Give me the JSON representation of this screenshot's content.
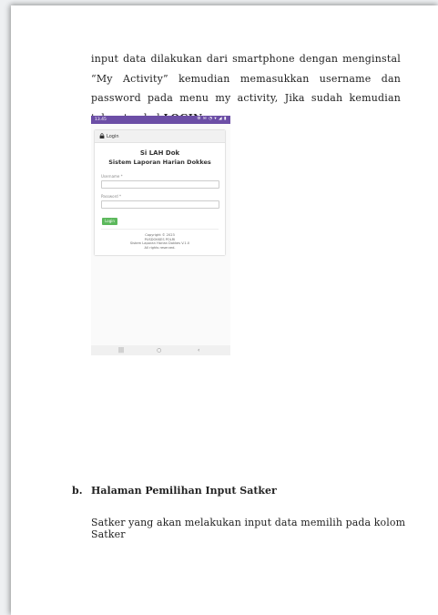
{
  "paragraph1": {
    "text": "input data dilakukan dari smartphone dengan menginstal “My Activity” kemudian memasukkan username dan password pada menu my activity, Jika sudah kemudian tekan tombol ",
    "bold": "LOGIN"
  },
  "phone_screenshot": {
    "status_time": "13.45",
    "status_icons": "⚙ ✉ ◔ ▾ ◢ ▮",
    "header_title": "Login",
    "app_title": "Si LAH Dok",
    "app_subtitle": "Sistem Laporan Harian Dokkes",
    "username_label": "Username *",
    "password_label": "Password *",
    "login_button": "Login",
    "copyright": [
      "Copyright © 2023",
      "PUSDOKKES POLRI",
      "Sistem Laporan Harian Dokkes V.1.0",
      "All rights reserved."
    ],
    "nav": {
      "recents": "|||",
      "home": "○",
      "back": "‹"
    }
  },
  "section_b": {
    "marker": "b.",
    "title": "Halaman Pemilihan Input Satker",
    "text": "Satker yang akan melakukan input data memilih pada kolom Satker"
  }
}
